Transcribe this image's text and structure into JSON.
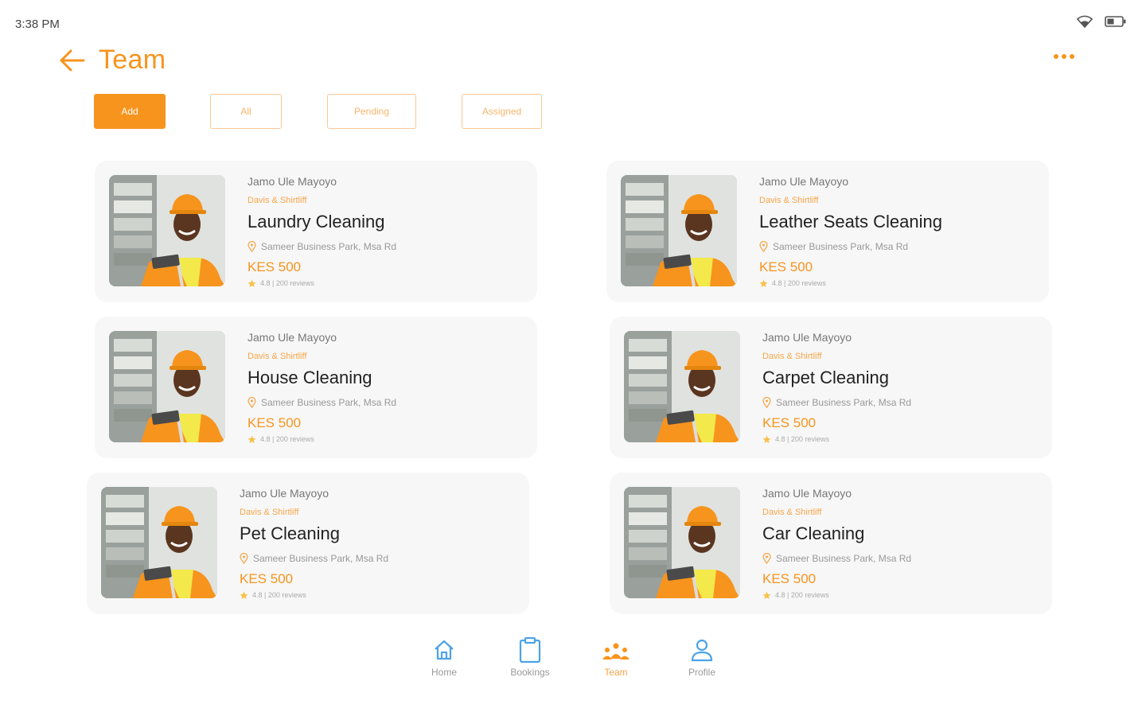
{
  "status_bar": {
    "time": "3:38 PM"
  },
  "header": {
    "title": "Team"
  },
  "filters": [
    {
      "label": "Add",
      "active": true
    },
    {
      "label": "All",
      "active": false
    },
    {
      "label": "Pending",
      "active": false
    },
    {
      "label": "Assigned",
      "active": false
    }
  ],
  "cards": [
    {
      "person": "Jamo Ule Mayoyo",
      "company": "Davis & Shirtliff",
      "service": "Laundry Cleaning",
      "location": "Sameer Business Park, Msa Rd",
      "price": "KES 500",
      "rating": "4.8 | 200 reviews"
    },
    {
      "person": "Jamo Ule Mayoyo",
      "company": "Davis & Shirtliff",
      "service": "Leather Seats Cleaning",
      "location": "Sameer Business Park, Msa Rd",
      "price": "KES 500",
      "rating": "4.8 | 200 reviews"
    },
    {
      "person": "Jamo Ule Mayoyo",
      "company": "Davis & Shirtliff",
      "service": "House Cleaning",
      "location": "Sameer Business Park, Msa Rd",
      "price": "KES 500",
      "rating": "4.8 | 200 reviews"
    },
    {
      "person": "Jamo Ule Mayoyo",
      "company": "Davis & Shirtliff",
      "service": "Carpet Cleaning",
      "location": "Sameer Business Park, Msa Rd",
      "price": "KES 500",
      "rating": "4.8 | 200 reviews"
    },
    {
      "person": "Jamo Ule Mayoyo",
      "company": "Davis & Shirtliff",
      "service": "Pet Cleaning",
      "location": "Sameer Business Park, Msa Rd",
      "price": "KES 500",
      "rating": "4.8 | 200 reviews"
    },
    {
      "person": "Jamo Ule Mayoyo",
      "company": "Davis & Shirtliff",
      "service": "Car Cleaning",
      "location": "Sameer Business Park, Msa Rd",
      "price": "KES 500",
      "rating": "4.8 | 200 reviews"
    }
  ],
  "nav": [
    {
      "label": "Home",
      "icon": "home-icon",
      "active": false
    },
    {
      "label": "Bookings",
      "icon": "clipboard-icon",
      "active": false
    },
    {
      "label": "Team",
      "icon": "team-icon",
      "active": true
    },
    {
      "label": "Profile",
      "icon": "profile-icon",
      "active": false
    }
  ],
  "colors": {
    "accent": "#F7941D",
    "nav_blue": "#4DA3E8",
    "card_bg": "#F7F7F7"
  }
}
